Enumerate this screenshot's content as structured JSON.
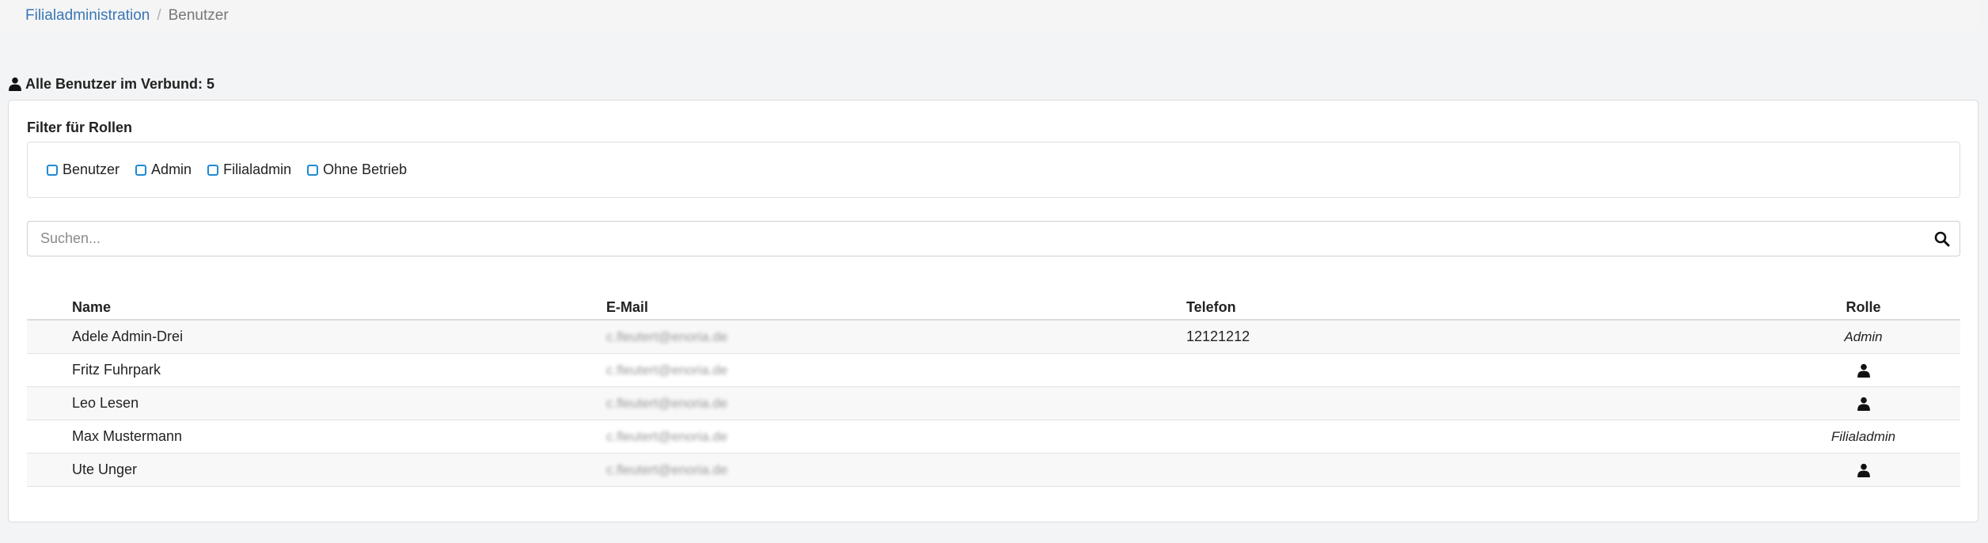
{
  "breadcrumb": {
    "parent": "Filialadministration",
    "separator": "/",
    "current": "Benutzer"
  },
  "heading": {
    "text": "Alle Benutzer im Verbund: 5",
    "icon": "person-icon"
  },
  "filter": {
    "title": "Filter für Rollen",
    "options": [
      {
        "label": "Benutzer",
        "checked": false
      },
      {
        "label": "Admin",
        "checked": false
      },
      {
        "label": "Filialadmin",
        "checked": false
      },
      {
        "label": "Ohne Betrieb",
        "checked": false
      }
    ]
  },
  "search": {
    "placeholder": "Suchen...",
    "value": "",
    "icon": "search-icon"
  },
  "table": {
    "columns": {
      "name": "Name",
      "email": "E-Mail",
      "phone": "Telefon",
      "role": "Rolle"
    },
    "rows": [
      {
        "name": "Adele Admin-Drei",
        "email": "c.fleutert@enoria.de",
        "phone": "12121212",
        "role": "Admin"
      },
      {
        "name": "Fritz Fuhrpark",
        "email": "c.fleutert@enoria.de",
        "phone": "",
        "role": ""
      },
      {
        "name": "Leo Lesen",
        "email": "c.fleutert@enoria.de",
        "phone": "",
        "role": ""
      },
      {
        "name": "Max Mustermann",
        "email": "c.fleutert@enoria.de",
        "phone": "",
        "role": "Filialadmin"
      },
      {
        "name": "Ute Unger",
        "email": "c.fleutert@enoria.de",
        "phone": "",
        "role": ""
      }
    ]
  },
  "colors": {
    "link": "#3a76b5",
    "checkbox_border": "#1f8ad6"
  }
}
